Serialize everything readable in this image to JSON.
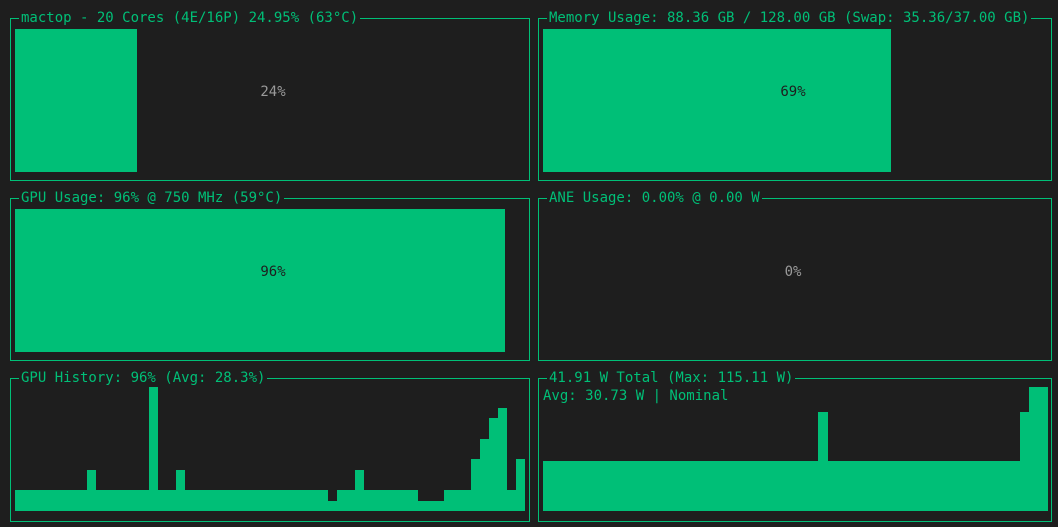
{
  "cpu": {
    "title": "mactop - 20 Cores (4E/16P) 24.95% (63°C)",
    "percent_label": "24%",
    "fill_fraction": 0.24
  },
  "memory": {
    "title": "Memory Usage: 88.36 GB / 128.00 GB (Swap: 35.36/37.00 GB)",
    "percent_label": "69%",
    "fill_fraction": 0.69
  },
  "gpu": {
    "title": "GPU Usage: 96% @ 750 MHz (59°C)",
    "percent_label": "96%",
    "fill_fraction": 0.96
  },
  "ane": {
    "title": "ANE Usage: 0.00% @ 0.00 W",
    "percent_label": "0%",
    "fill_fraction": 0.0
  },
  "gpu_history": {
    "title": "GPU History: 96% (Avg: 28.3%)",
    "values": [
      2,
      2,
      2,
      2,
      2,
      2,
      2,
      2,
      4,
      2,
      2,
      2,
      2,
      2,
      2,
      12,
      2,
      2,
      4,
      2,
      2,
      2,
      2,
      2,
      2,
      2,
      2,
      2,
      2,
      2,
      2,
      2,
      2,
      2,
      2,
      1,
      2,
      2,
      4,
      2,
      2,
      2,
      2,
      2,
      2,
      1,
      1,
      1,
      2,
      2,
      2,
      5,
      7,
      9,
      10,
      2,
      5
    ]
  },
  "power": {
    "title": "41.91 W Total (Max: 115.11 W)",
    "subtitle": "Avg: 30.73 W | Nominal",
    "values": [
      2,
      2,
      2,
      2,
      2,
      2,
      2,
      2,
      2,
      2,
      2,
      2,
      2,
      2,
      2,
      2,
      2,
      2,
      2,
      2,
      2,
      2,
      2,
      2,
      2,
      2,
      2,
      2,
      2,
      2,
      4,
      2,
      2,
      2,
      2,
      2,
      2,
      2,
      2,
      2,
      2,
      2,
      2,
      2,
      2,
      2,
      2,
      2,
      2,
      2,
      2,
      2,
      4,
      5,
      5
    ]
  }
}
